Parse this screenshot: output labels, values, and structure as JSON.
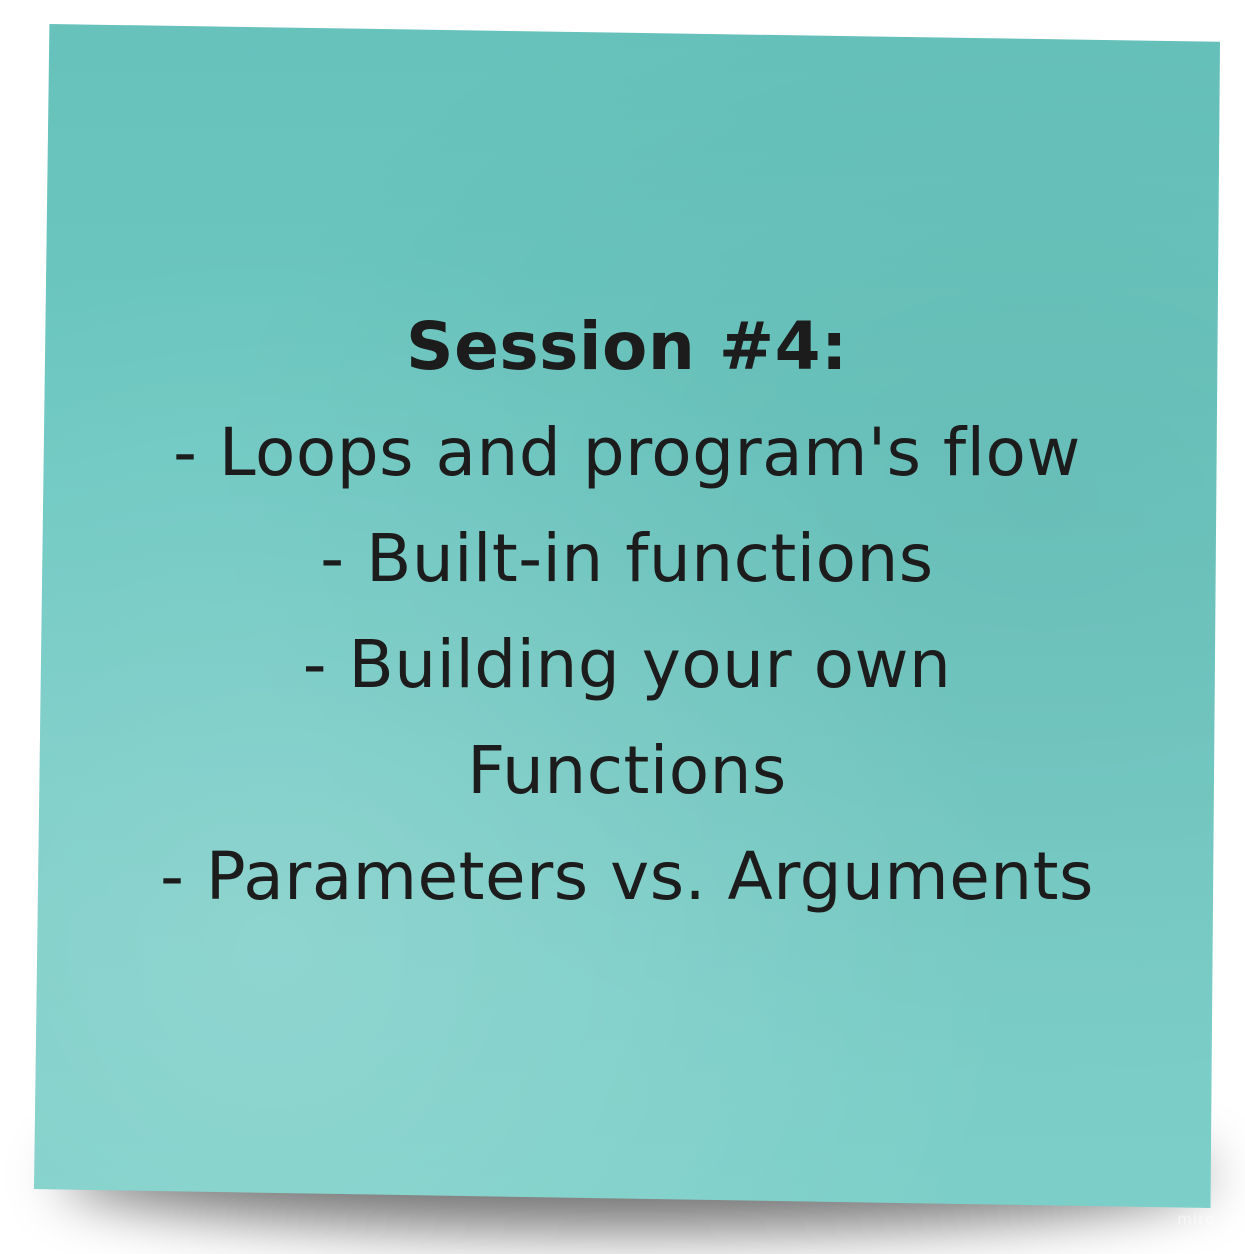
{
  "sticky_note": {
    "color": "#6ec8c2",
    "title": "Session #4:",
    "lines": [
      "- Loops and program's flow",
      "- Built-in functions",
      "- Building your own",
      "Functions",
      "- Parameters vs. Arguments"
    ]
  },
  "watermark": "miro"
}
